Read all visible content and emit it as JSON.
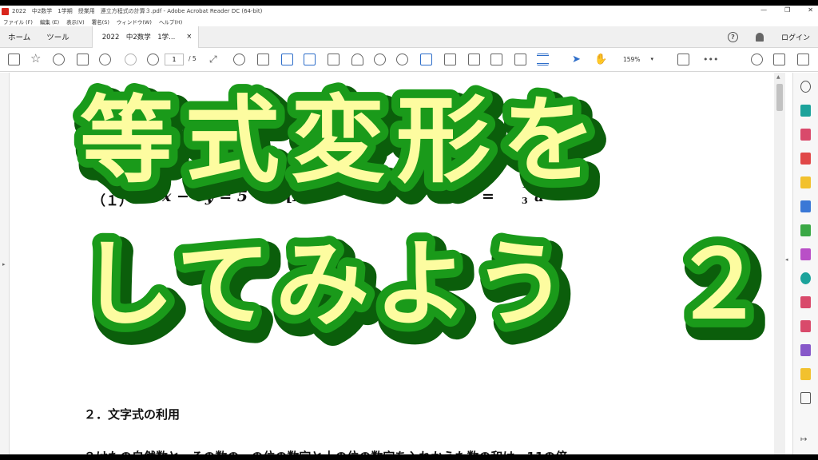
{
  "window": {
    "title": "2022　中2数学　1学期　授業用　連立方程式の計算３.pdf - Adobe Acrobat Reader DC (64-bit)",
    "minimize": "—",
    "restore": "❐",
    "close": "✕"
  },
  "menu": [
    "ファイル (F)",
    "編集 (E)",
    "表示(V)",
    "署名(S)",
    "ウィンドウ(W)",
    "ヘルプ(H)"
  ],
  "tabs": {
    "home": "ホーム",
    "tools": "ツール",
    "document": "2022　中2数学　1学...",
    "close": "×",
    "login": "ログイン",
    "help": "?"
  },
  "toolbar": {
    "page_current": "1",
    "page_total": "/ 5",
    "zoom": "159%"
  },
  "document": {
    "problem_1": "（１）",
    "problem_1_expr": "x − 6y = 5",
    "problem_1_var": "[x]",
    "problem_2_expr": "= ",
    "problem_2_fraction_num": "1",
    "problem_2_fraction_den": "3",
    "problem_2_var": "a",
    "section_2": "２．文字式の利用",
    "bottom_line": "２けたの自然数と、その数の一の位の数字と十の位の数字を入れかえた数の和は、11の倍"
  },
  "overlay": {
    "line1": "等式変形を",
    "line2": "してみよう　２",
    "fill": "#fdfca0",
    "stroke_inner": "#1a9a1a",
    "stroke_outer": "#0b5e0b"
  }
}
